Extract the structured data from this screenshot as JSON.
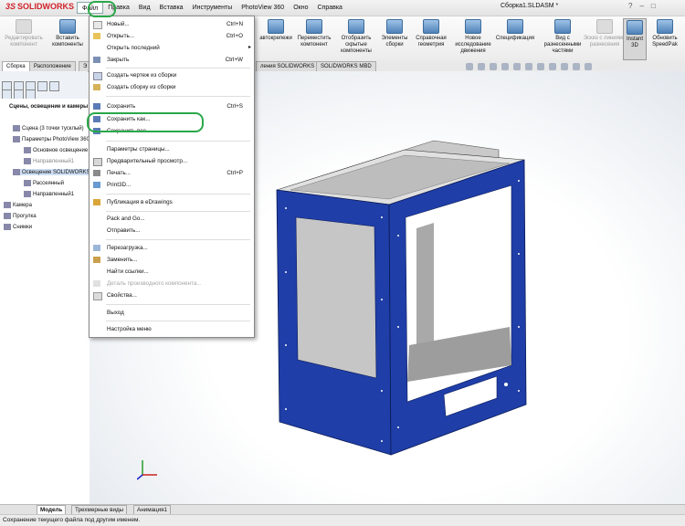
{
  "app": {
    "logo": "SOLIDWORKS",
    "document_title": "Сборка1.SLDASM *",
    "menus": [
      "Файл",
      "Правка",
      "Вид",
      "Вставка",
      "Инструменты",
      "PhotoView 360",
      "Окно",
      "Справка"
    ]
  },
  "toolbar": {
    "edit_component": "Редактировать компонент",
    "insert_components": "Вставить компоненты",
    "smart_fasteners": "автокрепежи",
    "move_component": "Переместить компонент",
    "show_hidden": "Отобразить скрытые компоненты",
    "assembly_features": "Элементы сборки",
    "reference_geometry": "Справочная геометрия",
    "new_motion_study": "Новое исследование движения",
    "bill_of_materials": "Спецификация",
    "exploded_view": "Вид с разнесенными частями",
    "explode_line_sketch": "Эскиз с линиями разнесения",
    "instant3d": "Instant 3D",
    "update_speedpak": "Обновить SpeedPak"
  },
  "command_tabs": [
    "Сборка",
    "Расположение",
    "Э",
    "ления SOLIDWORKS",
    "SOLIDWORKS MBD"
  ],
  "tree": {
    "title": "Сцены, освещение и камеры",
    "nodes": [
      {
        "label": "Сцена (3 точки тусклый)",
        "style": "normal"
      },
      {
        "label": "Параметры PhotoView 360",
        "style": "normal"
      },
      {
        "label": "Основное освещение",
        "style": "normal"
      },
      {
        "label": "Направленный1",
        "style": "gray"
      },
      {
        "label": "Освещение SOLIDWORKS",
        "style": "selected"
      },
      {
        "label": "Рассеянный",
        "style": "normal"
      },
      {
        "label": "Направленный1",
        "style": "normal"
      },
      {
        "label": "Камера",
        "style": "normal"
      },
      {
        "label": "Прогулка",
        "style": "normal"
      },
      {
        "label": "Снимки",
        "style": "normal"
      }
    ]
  },
  "file_menu": {
    "items": [
      {
        "label": "Новый...",
        "shortcut": "Ctrl+N",
        "disabled": false
      },
      {
        "label": "Открыть...",
        "shortcut": "Ctrl+O",
        "disabled": false
      },
      {
        "label": "Открыть последний",
        "shortcut": "",
        "disabled": false,
        "submenu": true
      },
      {
        "label": "Закрыть",
        "shortcut": "Ctrl+W",
        "disabled": false
      },
      {
        "label": "Создать чертеж из сборки",
        "shortcut": "",
        "disabled": false
      },
      {
        "label": "Создать сборку из сборки",
        "shortcut": "",
        "disabled": false
      },
      {
        "label": "Сохранить",
        "shortcut": "Ctrl+S",
        "disabled": false
      },
      {
        "label": "Сохранить как...",
        "shortcut": "",
        "disabled": false,
        "highlighted": true
      },
      {
        "label": "Сохранить все",
        "shortcut": "",
        "disabled": false
      },
      {
        "label": "Параметры страницы...",
        "shortcut": "",
        "disabled": false
      },
      {
        "label": "Предварительный просмотр...",
        "shortcut": "",
        "disabled": false
      },
      {
        "label": "Печать...",
        "shortcut": "Ctrl+P",
        "disabled": false
      },
      {
        "label": "Print3D...",
        "shortcut": "",
        "disabled": false
      },
      {
        "label": "Публикация в eDrawings",
        "shortcut": "",
        "disabled": false
      },
      {
        "label": "Pack and Go...",
        "shortcut": "",
        "disabled": false
      },
      {
        "label": "Отправить...",
        "shortcut": "",
        "disabled": false
      },
      {
        "label": "Перезагрузка...",
        "shortcut": "",
        "disabled": false
      },
      {
        "label": "Заменить...",
        "shortcut": "",
        "disabled": false
      },
      {
        "label": "Найти ссылки...",
        "shortcut": "",
        "disabled": false
      },
      {
        "label": "Деталь производного компонента...",
        "shortcut": "",
        "disabled": true
      },
      {
        "label": "Свойства...",
        "shortcut": "",
        "disabled": false
      },
      {
        "label": "Выход",
        "shortcut": "",
        "disabled": false
      },
      {
        "label": "Настройка меню",
        "shortcut": "",
        "disabled": false
      }
    ]
  },
  "bottom_tabs": [
    "Модель",
    "Трехмерные виды",
    "Анимация1"
  ],
  "status": "Сохранение текущего файла под другим именем.",
  "colors": {
    "frame_blue": "#1f3ea8",
    "highlight_green": "#2aa84a",
    "logo_red": "#d1232a"
  }
}
